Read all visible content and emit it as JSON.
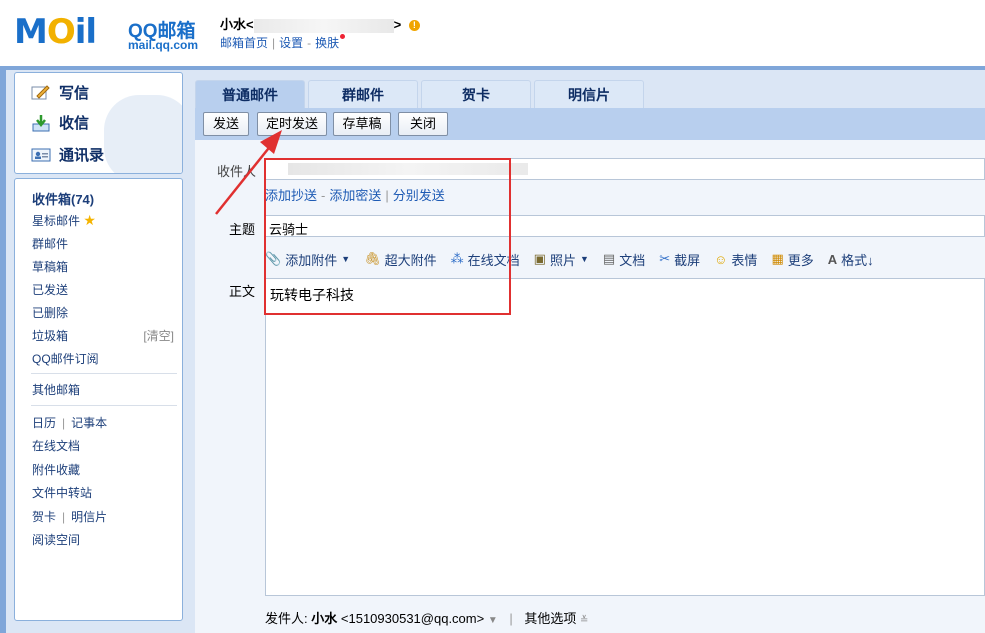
{
  "header": {
    "logo_text": "MOil",
    "brand_title": "QQ邮箱",
    "brand_domain": "mail.qq.com",
    "user_name": "小水",
    "user_email_open": "<",
    "user_email_close": ">",
    "links": [
      "邮箱首页",
      "设置",
      "换肤"
    ]
  },
  "sidebar": {
    "primary_buttons": [
      {
        "label": "写信",
        "icon": "compose-icon"
      },
      {
        "label": "收信",
        "icon": "inbox-download-icon"
      },
      {
        "label": "通讯录",
        "icon": "contacts-icon"
      }
    ],
    "folders": [
      {
        "label": "收件箱(74)"
      },
      {
        "label": "星标邮件"
      },
      {
        "label": "群邮件"
      },
      {
        "label": "草稿箱"
      },
      {
        "label": "已发送"
      },
      {
        "label": "已删除"
      },
      {
        "label": "垃圾箱",
        "action": "[清空]"
      },
      {
        "label": "QQ邮件订阅"
      }
    ],
    "other_mailbox": "其他邮箱",
    "tools": [
      {
        "label": "日历",
        "pair": "记事本"
      },
      {
        "label": "在线文档"
      },
      {
        "label": "附件收藏"
      },
      {
        "label": "文件中转站"
      },
      {
        "label": "贺卡",
        "pair": "明信片"
      },
      {
        "label": "阅读空间"
      }
    ]
  },
  "tabs": [
    "普通邮件",
    "群邮件",
    "贺卡",
    "明信片"
  ],
  "toolbar": {
    "send": "发送",
    "scheduled_send": "定时发送",
    "save_draft": "存草稿",
    "close": "关闭"
  },
  "compose": {
    "to_label": "收件人",
    "cc_link": "添加抄送",
    "bcc_link": "添加密送",
    "separate_link": "分别发送",
    "subject_label": "主题",
    "subject_value": "云骑士",
    "body_label": "正文",
    "body_value": "玩转电子科技",
    "format_tools": [
      "添加附件",
      "超大附件",
      "在线文档",
      "照片",
      "文档",
      "截屏",
      "表情",
      "更多",
      "格式↓"
    ]
  },
  "footer": {
    "sender_label": "发件人:",
    "sender_name": "小水",
    "sender_email": "<1510930531@qq.com>",
    "more_options": "其他选项"
  },
  "colors": {
    "frame": "#7fa6d9",
    "tab_active": "#b8cfee",
    "link": "#1d5ab4",
    "annotation": "#e03030"
  }
}
